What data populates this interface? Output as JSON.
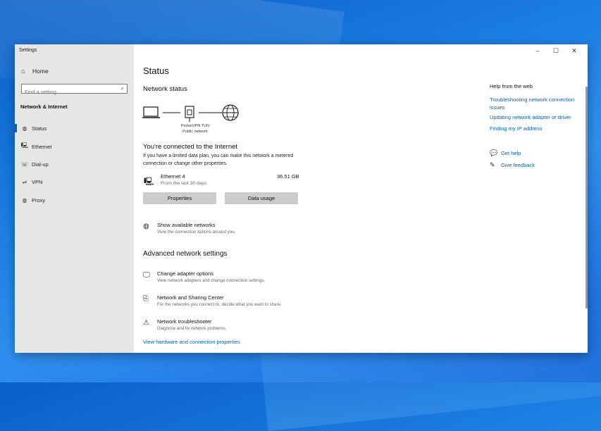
{
  "window": {
    "title": "Settings",
    "controls": [
      "–",
      "☐",
      "✕"
    ]
  },
  "sidebar": {
    "home": "Home",
    "search_placeholder": "Find a setting",
    "section": "Network & Internet",
    "items": [
      {
        "label": "Status",
        "icon": "globe-icon"
      },
      {
        "label": "Ethernet",
        "icon": "ethernet-icon"
      },
      {
        "label": "Dial-up",
        "icon": "dial-up-icon"
      },
      {
        "label": "VPN",
        "icon": "vpn-icon"
      },
      {
        "label": "Proxy",
        "icon": "proxy-globe-icon"
      }
    ]
  },
  "main": {
    "title": "Status",
    "network_status": "Network status",
    "diagram": {
      "name": "ProtonVPN TUN",
      "type": "Public network"
    },
    "connected_title": "You're connected to the Internet",
    "connected_desc": "If you have a limited data plan, you can make this network a metered connection or change other properties.",
    "adapter": {
      "name": "Ethernet 4",
      "sub": "From the last 30 days",
      "usage": "36.51 GB"
    },
    "buttons": {
      "properties": "Properties",
      "data_usage": "Data usage"
    },
    "show_networks": {
      "title": "Show available networks",
      "desc": "View the connection options around you."
    },
    "advanced_title": "Advanced network settings",
    "advanced": [
      {
        "title": "Change adapter options",
        "desc": "View network adapters and change connection settings."
      },
      {
        "title": "Network and Sharing Center",
        "desc": "For the networks you connect to, decide what you want to share."
      },
      {
        "title": "Network troubleshooter",
        "desc": "Diagnose and fix network problems."
      }
    ],
    "hardware_link": "View hardware and connection properties"
  },
  "right_panel": {
    "title": "Help from the web",
    "links": [
      "Troubleshooting network connection issues",
      "Updating network adapter or driver",
      "Finding my IP address"
    ],
    "get_help": "Get help",
    "give_feedback": "Give feedback"
  },
  "colors": {
    "accent": "#0063b1",
    "sidebar_bg": "#e6e6e6",
    "desktop": "#1a7be0"
  }
}
